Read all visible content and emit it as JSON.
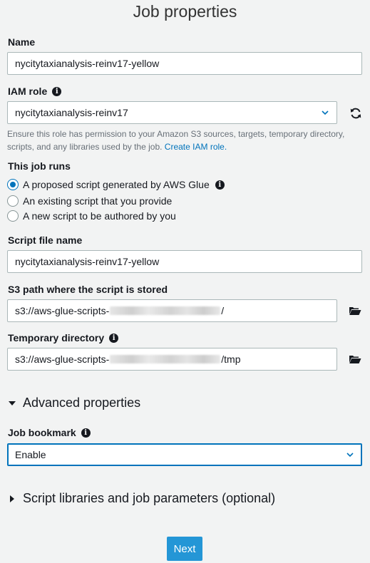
{
  "page": {
    "title": "Job properties"
  },
  "name": {
    "label": "Name",
    "value": "nycitytaxianalysis-reinv17-yellow"
  },
  "iam_role": {
    "label": "IAM role",
    "value": "nycitytaxianalysis-reinv17",
    "helper_text": "Ensure this role has permission to your Amazon S3 sources, targets, temporary directory, scripts, and any libraries used by the job.",
    "helper_link": "Create IAM role."
  },
  "job_runs": {
    "label": "This job runs",
    "options": [
      {
        "label": "A proposed script generated by AWS Glue",
        "selected": true
      },
      {
        "label": "An existing script that you provide",
        "selected": false
      },
      {
        "label": "A new script to be authored by you",
        "selected": false
      }
    ]
  },
  "script_file": {
    "label": "Script file name",
    "value": "nycitytaxianalysis-reinv17-yellow"
  },
  "s3_path": {
    "label": "S3 path where the script is stored",
    "prefix": "s3://aws-glue-scripts-",
    "suffix": "/"
  },
  "temp_dir": {
    "label": "Temporary directory",
    "prefix": "s3://aws-glue-scripts-",
    "suffix": "/tmp"
  },
  "advanced": {
    "label": "Advanced properties"
  },
  "job_bookmark": {
    "label": "Job bookmark",
    "value": "Enable"
  },
  "script_libraries": {
    "label": "Script libraries and job parameters (optional)"
  },
  "footer": {
    "next_label": "Next"
  },
  "colors": {
    "accent": "#0073bb",
    "button": "#2496d6",
    "background": "#f2f3f3"
  }
}
